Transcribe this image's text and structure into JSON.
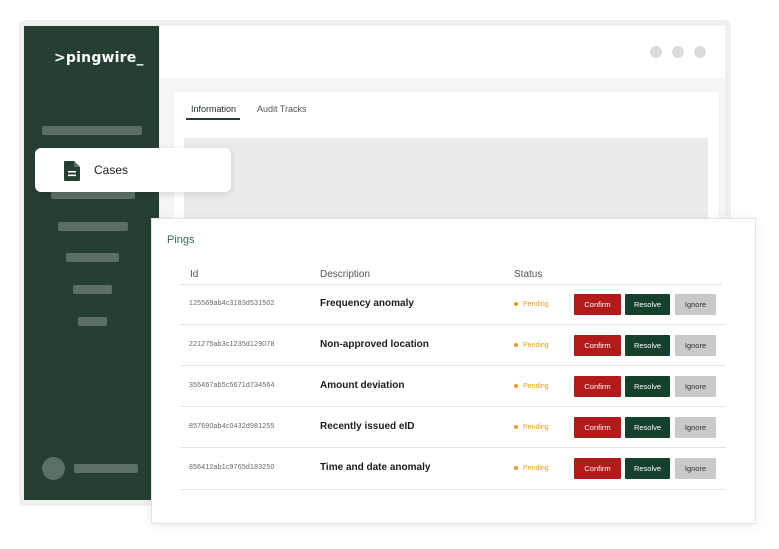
{
  "app": {
    "logo": ">pingwire_",
    "tabs": [
      "Information",
      "Audit Tracks"
    ],
    "cases_label": "Cases",
    "pings_title": "Pings"
  },
  "table": {
    "headers": {
      "id": "Id",
      "description": "Description",
      "status": "Status"
    },
    "rows": [
      {
        "id": "125569ab4c3183d531502",
        "description": "Frequency anomaly",
        "status": "Pending"
      },
      {
        "id": "221275ab3c1235d129078",
        "description": "Non-approved location",
        "status": "Pending"
      },
      {
        "id": "355467ab5c5671d734564",
        "description": "Amount deviation",
        "status": "Pending"
      },
      {
        "id": "857690ab4c0432d981255",
        "description": "Recently issued eID",
        "status": "Pending"
      },
      {
        "id": "856412ab1c9765d183250",
        "description": "Time and date anomaly",
        "status": "Pending"
      }
    ],
    "actions": {
      "confirm": "Confirm",
      "resolve": "Resolve",
      "ignore": "Ignore"
    }
  },
  "colors": {
    "sidebar": "#263f33",
    "confirm": "#b31a1a",
    "resolve": "#14402c",
    "ignore": "#c9c9c9",
    "pending": "#f09a1a"
  }
}
